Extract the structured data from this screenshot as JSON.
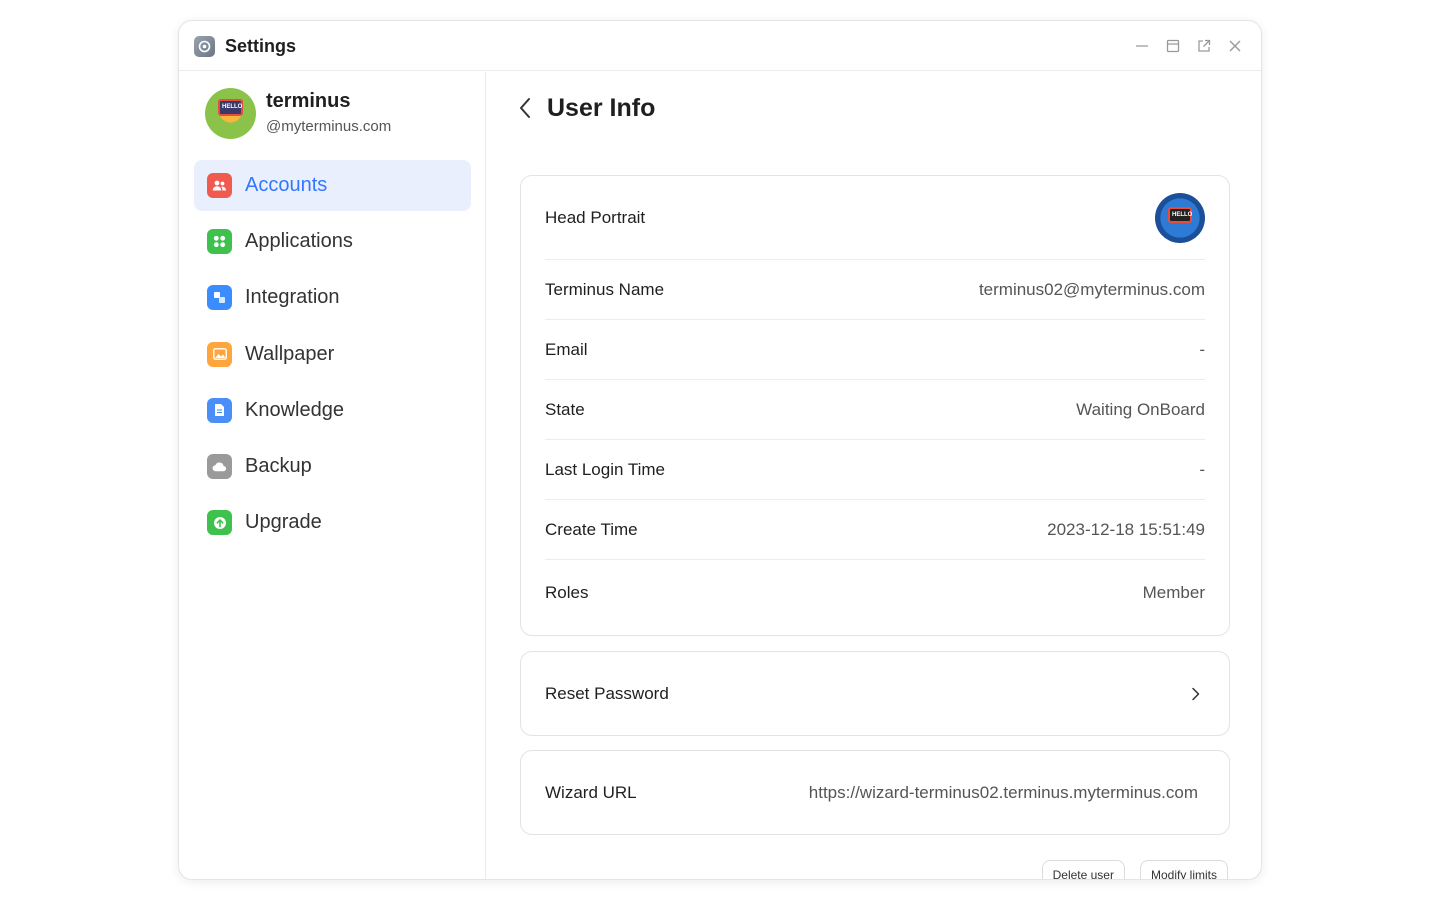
{
  "window": {
    "title": "Settings"
  },
  "profile": {
    "name": "terminus",
    "domain": "@myterminus.com",
    "avatar_text": "HELLO"
  },
  "sidebar": {
    "items": [
      {
        "label": "Accounts",
        "icon": "accounts-icon",
        "color": "#f05a4f",
        "active": true
      },
      {
        "label": "Applications",
        "icon": "applications-icon",
        "color": "#3ec14d",
        "active": false
      },
      {
        "label": "Integration",
        "icon": "integration-icon",
        "color": "#3a8cff",
        "active": false
      },
      {
        "label": "Wallpaper",
        "icon": "wallpaper-icon",
        "color": "#ffa53d",
        "active": false
      },
      {
        "label": "Knowledge",
        "icon": "knowledge-icon",
        "color": "#4a8ff7",
        "active": false
      },
      {
        "label": "Backup",
        "icon": "backup-icon",
        "color": "#9a9a9a",
        "active": false
      },
      {
        "label": "Upgrade",
        "icon": "upgrade-icon",
        "color": "#3ec14d",
        "active": false
      }
    ]
  },
  "main": {
    "title": "User Info",
    "info": {
      "head_portrait_label": "Head Portrait",
      "portrait_text": "HELLO",
      "rows": [
        {
          "label": "Terminus Name",
          "value": "terminus02@myterminus.com"
        },
        {
          "label": "Email",
          "value": "-"
        },
        {
          "label": "State",
          "value": "Waiting OnBoard"
        },
        {
          "label": "Last Login Time",
          "value": "-"
        },
        {
          "label": "Create Time",
          "value": "2023-12-18 15:51:49"
        },
        {
          "label": "Roles",
          "value": "Member"
        }
      ]
    },
    "reset_password_label": "Reset Password",
    "wizard": {
      "label": "Wizard URL",
      "value": "https://wizard-terminus02.terminus.myterminus.com"
    },
    "actions": {
      "delete_label": "Delete user",
      "modify_label": "Modify limits"
    }
  },
  "colors": {
    "accent": "#3377ff",
    "active_bg": "#e9effd"
  }
}
